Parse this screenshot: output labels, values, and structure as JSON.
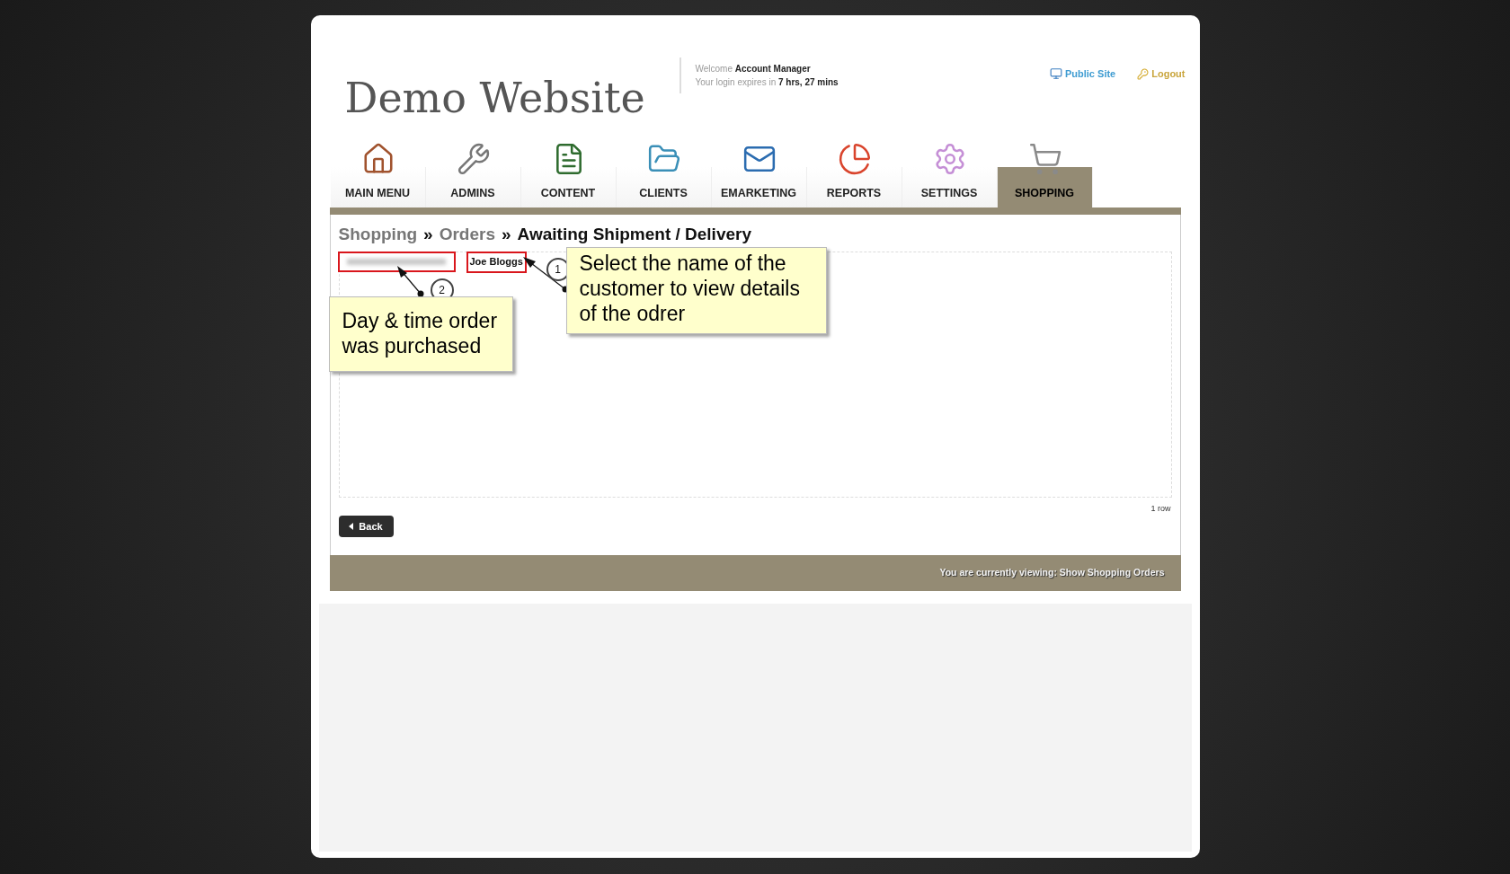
{
  "header": {
    "site_title": "Demo Website",
    "welcome_label": "Welcome",
    "user_name": "Account Manager",
    "expiry_label": "Your login expires in",
    "expiry_value": "7 hrs, 27 mins",
    "links": [
      {
        "label": "Public Site"
      },
      {
        "label": "Logout"
      }
    ]
  },
  "nav": [
    {
      "label": "MAIN MENU",
      "selected": false
    },
    {
      "label": "ADMINS",
      "selected": false
    },
    {
      "label": "CONTENT",
      "selected": false
    },
    {
      "label": "CLIENTS",
      "selected": false
    },
    {
      "label": "EMARKETING",
      "selected": false
    },
    {
      "label": "REPORTS",
      "selected": false
    },
    {
      "label": "SETTINGS",
      "selected": false
    },
    {
      "label": "SHOPPING",
      "selected": true
    }
  ],
  "breadcrumb": [
    {
      "label": "Shopping",
      "kind": "link"
    },
    {
      "label": "»",
      "kind": "separator"
    },
    {
      "label": "Orders",
      "kind": "link"
    },
    {
      "label": "»",
      "kind": "separator"
    },
    {
      "label": "Awaiting Shipment / Delivery",
      "kind": "current"
    }
  ],
  "orders": {
    "rows": [
      {
        "customer": "Joe Bloggs"
      }
    ],
    "row_count": "1 row"
  },
  "back_button": "Back",
  "footer": "You are currently viewing: Show Shopping Orders",
  "annotations": [
    {
      "number": "1",
      "text": "Select the name of the customer to view details of the odrer"
    },
    {
      "number": "2",
      "text": "Day & time order was purchased"
    }
  ]
}
